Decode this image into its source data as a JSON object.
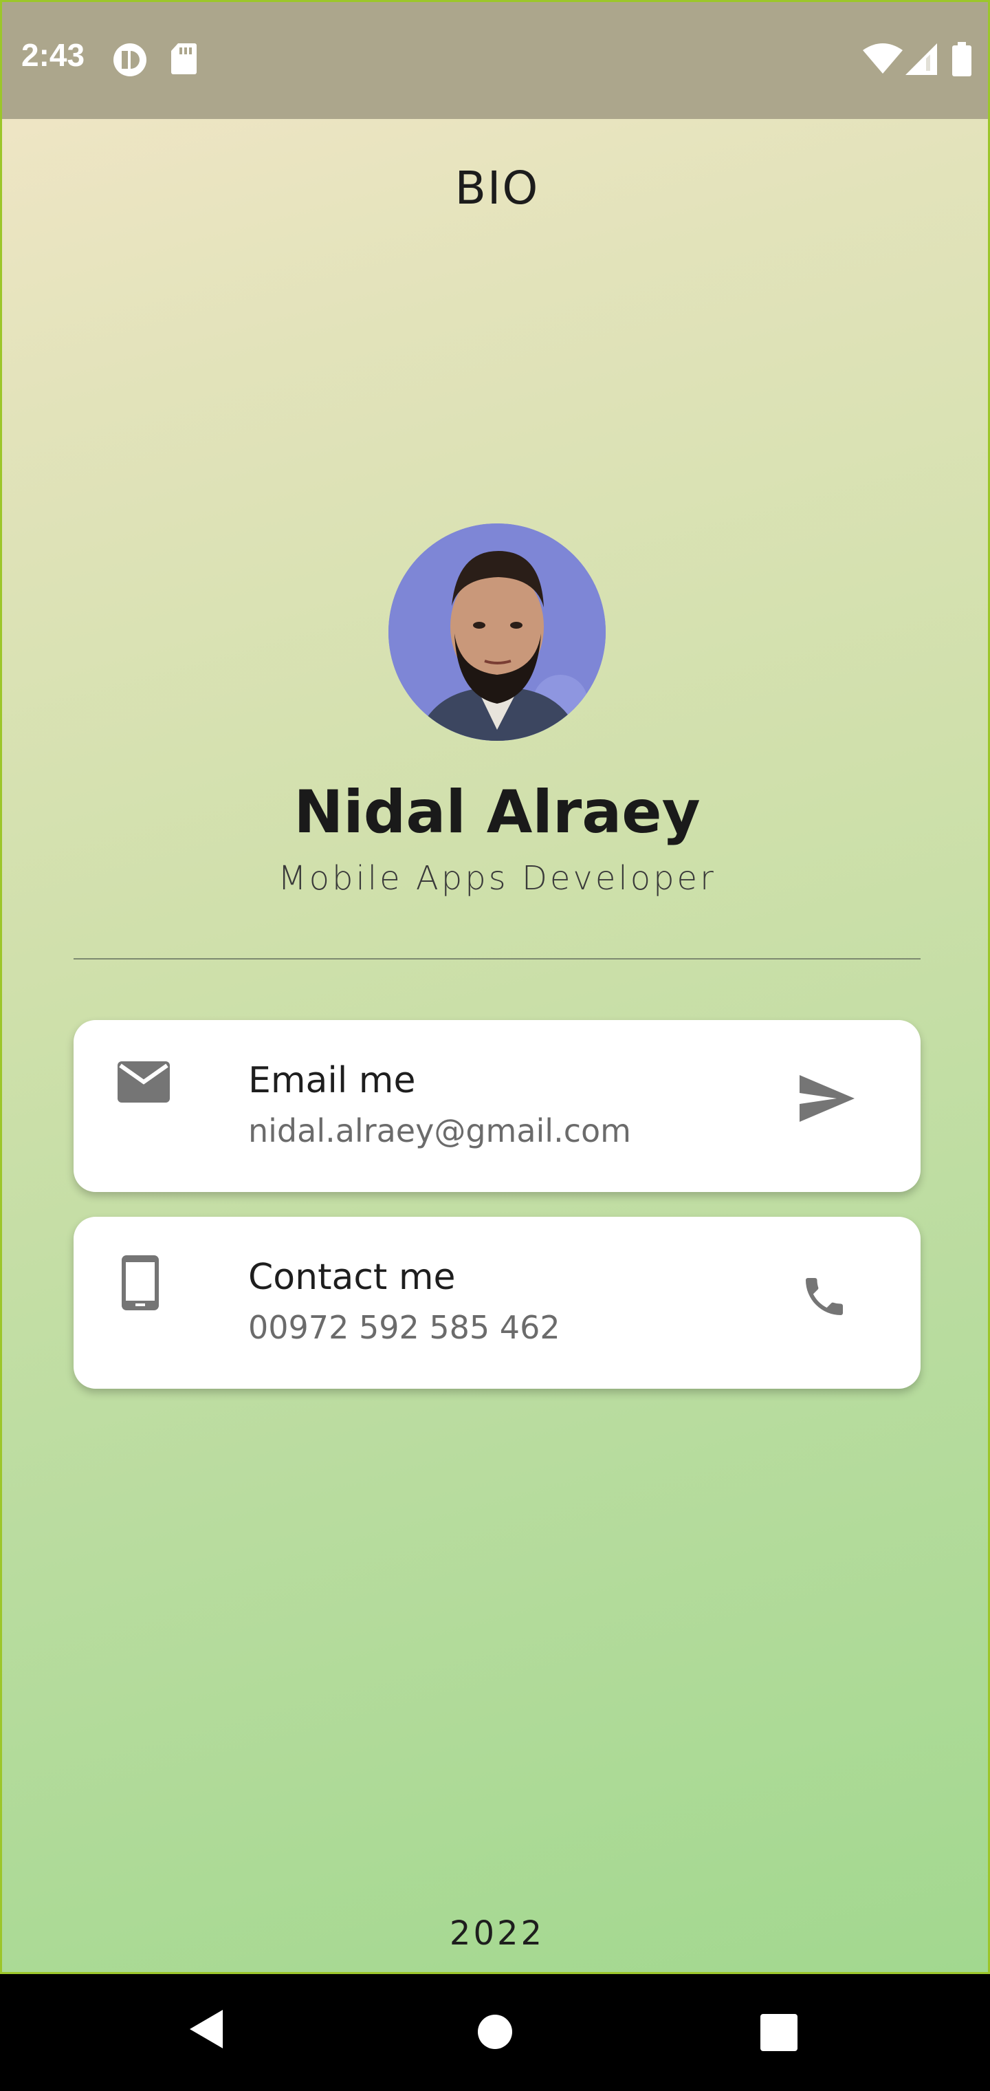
{
  "status_bar": {
    "time": "2:43"
  },
  "app_bar": {
    "title": "BIO"
  },
  "profile": {
    "name": "Nidal Alraey",
    "role": "Mobile Apps Developer"
  },
  "cards": [
    {
      "title": "Email me",
      "subtitle": "nidal.alraey@gmail.com",
      "icon": "email-icon",
      "action_icon": "send-icon"
    },
    {
      "title": "Contact me",
      "subtitle": "00972 592 585 462",
      "icon": "smartphone-icon",
      "action_icon": "phone-icon"
    }
  ],
  "footer": {
    "year": "2022"
  },
  "colors": {
    "accent_border": "#9cc62a",
    "icon_gray": "#757575",
    "status_bar": "#aca68c"
  }
}
